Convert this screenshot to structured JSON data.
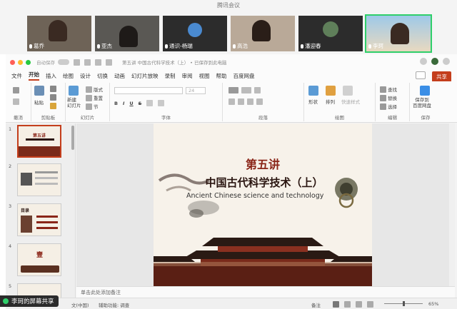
{
  "meeting": {
    "title": "腾讯会议",
    "participants": [
      {
        "name": "葛乔",
        "color": "#7a6a5a",
        "active": false
      },
      {
        "name": "亚杰",
        "color": "#5a4a44",
        "active": false
      },
      {
        "name": "通识-杨瑞",
        "color": "#2e6fb0",
        "active": false
      },
      {
        "name": "高浩",
        "color": "#6b5a50",
        "active": false
      },
      {
        "name": "潘迎春",
        "color": "#3b5a3a",
        "active": false
      },
      {
        "name": "李珂",
        "color": "#8fb9d9",
        "active": true
      }
    ]
  },
  "ppt": {
    "autosave": "自动保存",
    "doc_title": "第五讲 中国古代科学技术（上） • 已保存到此电脑",
    "tabs": [
      "文件",
      "开始",
      "插入",
      "绘图",
      "设计",
      "切换",
      "动画",
      "幻灯片放映",
      "录制",
      "审阅",
      "视图",
      "帮助",
      "百度网盘"
    ],
    "active_tab": "开始",
    "share_label": "共享",
    "ribbon": {
      "undo": "撤消",
      "clipboard": "剪贴板",
      "paste": "粘贴",
      "new_slide": "新建\n幻灯片",
      "layout": "版式",
      "reset": "重置",
      "section": "节",
      "slides": "幻灯片",
      "font": "字体",
      "font_size": "24",
      "paragraph": "段落",
      "arrange": "排列",
      "quick_styles": "快速样式",
      "shapes": "形状",
      "drawing": "绘图",
      "find": "查找",
      "replace": "替换",
      "select": "选择",
      "editing": "编辑",
      "save_baidu": "保存到\n百度网盘",
      "save": "保存"
    },
    "thumbnails": [
      {
        "num": "1",
        "text": "第五讲",
        "selected": true
      },
      {
        "num": "2",
        "text": "",
        "selected": false
      },
      {
        "num": "3",
        "text": "目录",
        "selected": false
      },
      {
        "num": "4",
        "text": "壹",
        "selected": false
      },
      {
        "num": "5",
        "text": "",
        "selected": false
      }
    ],
    "slide": {
      "title1": "第五讲",
      "title2": "中国古代科学技术（上）",
      "subtitle": "Ancient Chinese science and technology"
    },
    "notes_placeholder": "单击此处添加备注",
    "status": {
      "language": "文(中国)",
      "accessibility": "辅助功能: 调查",
      "notes": "备注",
      "zoom": "65%"
    }
  },
  "screen_share": "李珂的屏幕共享"
}
